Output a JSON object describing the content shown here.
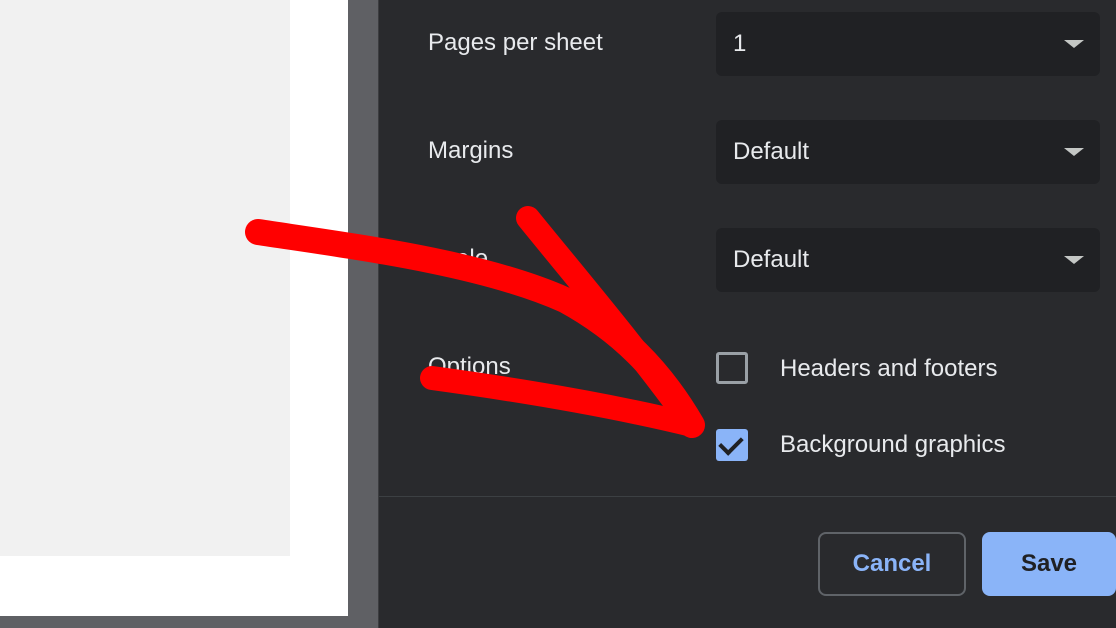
{
  "settings": {
    "pages_per_sheet": {
      "label": "Pages per sheet",
      "value": "1"
    },
    "margins": {
      "label": "Margins",
      "value": "Default"
    },
    "scale": {
      "label": "Scale",
      "value": "Default"
    },
    "options": {
      "label": "Options",
      "headers_footers": {
        "label": "Headers and footers",
        "checked": false
      },
      "background_graphics": {
        "label": "Background graphics",
        "checked": true
      }
    }
  },
  "footer": {
    "cancel_label": "Cancel",
    "save_label": "Save"
  },
  "colors": {
    "panel_bg": "#292a2d",
    "select_bg": "#202124",
    "accent": "#8ab4f8",
    "annotation": "#ff0000"
  },
  "icons": {
    "dropdown": "chevron-down-icon",
    "checkbox_checked": "check-icon",
    "annotation": "red-arrow-annotation"
  }
}
